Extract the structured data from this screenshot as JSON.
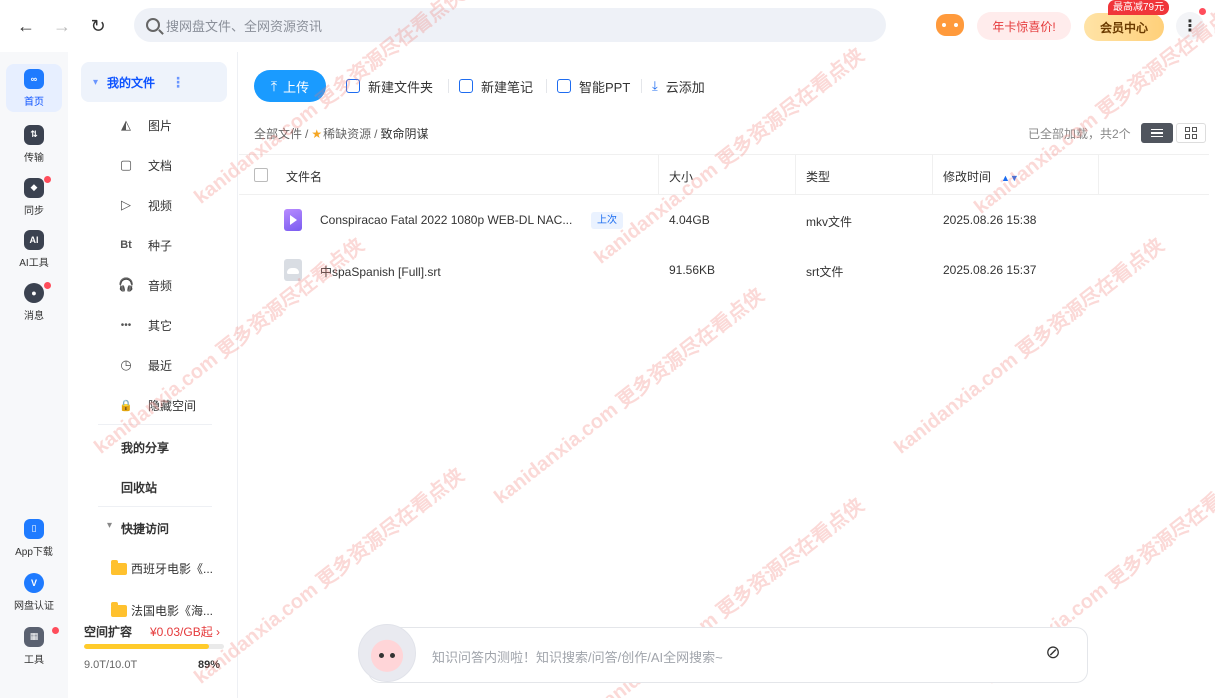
{
  "topbar": {
    "search_placeholder": "搜网盘文件、全网资源资讯",
    "promo_label": "年卡惊喜价!",
    "vip_label": "会员中心",
    "vip_tag": "最高减79元"
  },
  "rail": {
    "items": [
      {
        "label": "首页",
        "icon": "home-icon"
      },
      {
        "label": "传输",
        "icon": "transfer-icon"
      },
      {
        "label": "同步",
        "icon": "sync-icon"
      },
      {
        "label": "AI工具",
        "icon": "ai-icon"
      },
      {
        "label": "消息",
        "icon": "message-icon"
      }
    ],
    "bottom": [
      {
        "label": "App下载",
        "icon": "phone-icon"
      },
      {
        "label": "网盘认证",
        "icon": "verify-icon"
      },
      {
        "label": "工具",
        "icon": "tools-icon"
      }
    ]
  },
  "sidenav": {
    "my_files": "我的文件",
    "items": [
      "图片",
      "文档",
      "视频",
      "种子",
      "音频",
      "其它",
      "最近",
      "隐藏空间"
    ],
    "item_glyphs": [
      "◭",
      "▢",
      "▷",
      "Bt",
      "🎧",
      "•••",
      "◷",
      "🔒"
    ],
    "my_share": "我的分享",
    "recycle": "回收站",
    "quick_access": "快捷访问",
    "quick_folders": [
      "西班牙电影《...",
      "法国电影《海..."
    ],
    "storage": {
      "title": "空间扩容",
      "price": "¥0.03/GB起 ›",
      "used": "9.0T/10.0T",
      "percent": "89%",
      "percent_value": 0.89
    }
  },
  "toolbar": {
    "upload": "上传",
    "new_folder": "新建文件夹",
    "new_note": "新建笔记",
    "smart_ppt": "智能PPT",
    "cloud_add": "云添加"
  },
  "breadcrumb": {
    "root": "全部文件",
    "sep1": "/",
    "parent": "稀缺资源",
    "sep2": "/",
    "current": "致命阴谋"
  },
  "list_info": "已全部加载，共2个",
  "table": {
    "headers": [
      "文件名",
      "大小",
      "类型",
      "修改时间"
    ],
    "rows": [
      {
        "name": "Conspiracao Fatal 2022 1080p WEB-DL NAC...",
        "tag": "上次",
        "size": "4.04GB",
        "type": "mkv文件",
        "modified": "2025.08.26 15:38",
        "icon": "video-file-icon"
      },
      {
        "name": "中spaSpanish [Full].srt",
        "tag": "",
        "size": "91.56KB",
        "type": "srt文件",
        "modified": "2025.08.26 15:37",
        "icon": "subtitle-file-icon"
      }
    ]
  },
  "ai_input": {
    "placeholder": "知识问答内测啦！知识搜索/问答/创作/AI全网搜索~"
  },
  "watermark": "kanidanxia.com 更多资源尽在看点侠"
}
